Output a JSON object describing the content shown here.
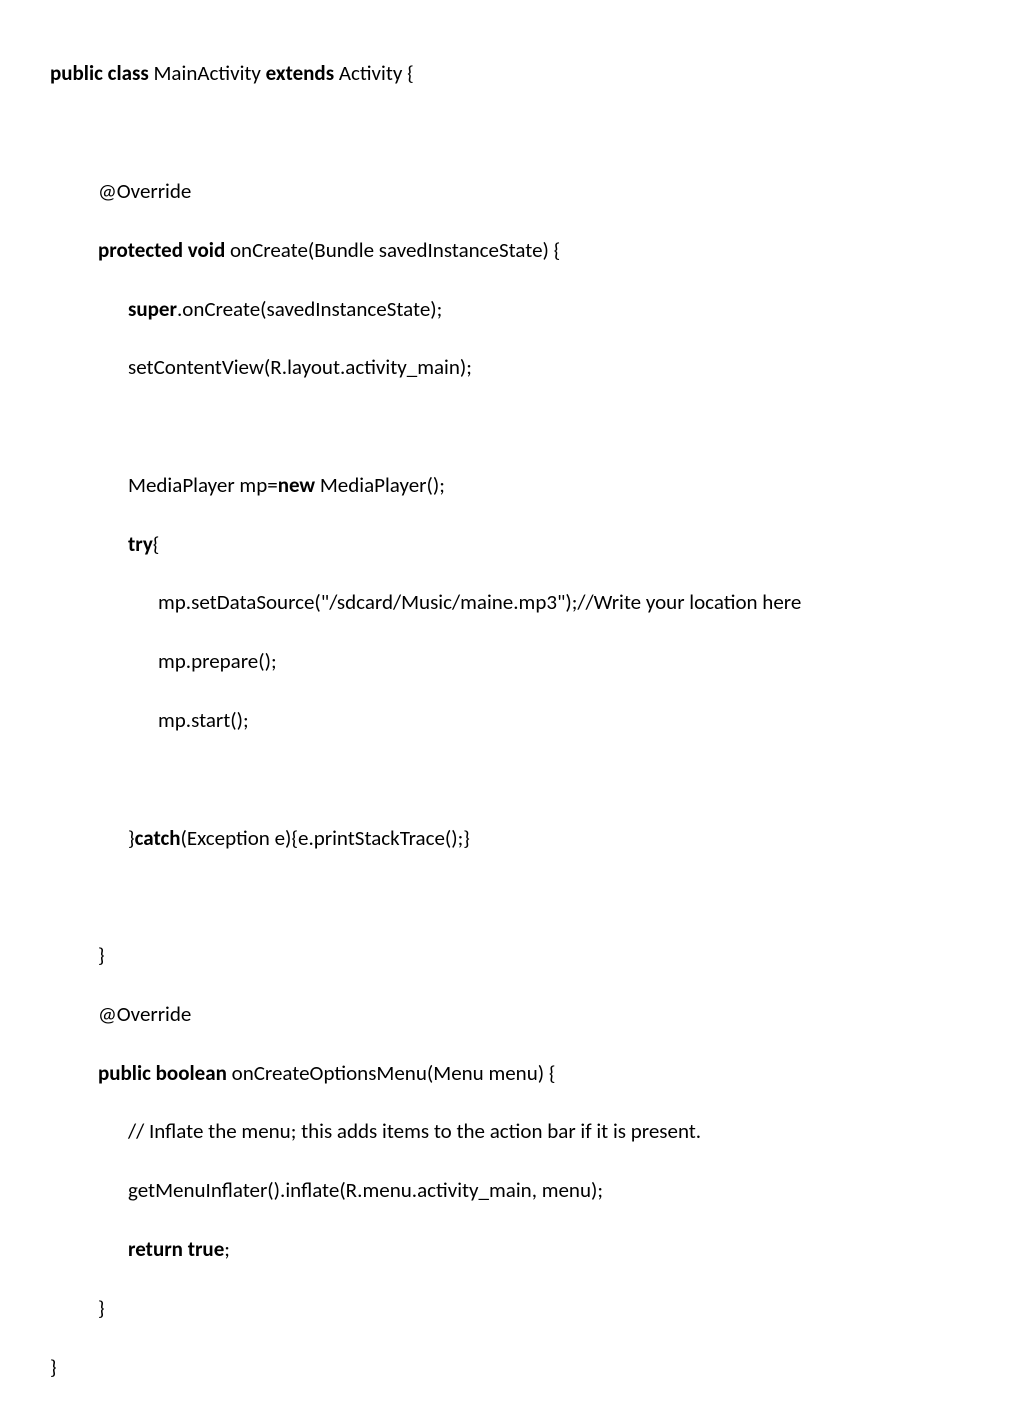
{
  "code": {
    "l1a": "public class",
    "l1b": " MainActivity ",
    "l1c": "extends",
    "l1d": " Activity {",
    "l3": "@Override",
    "l4a": "protected void",
    "l4b": " onCreate(Bundle savedInstanceState) {",
    "l5a": "super",
    "l5b": ".onCreate(savedInstanceState);",
    "l6": "setContentView(R.layout.activity_main);",
    "l8a": "MediaPlayer mp=",
    "l8b": "new",
    "l8c": " MediaPlayer();",
    "l9a": "try",
    "l9b": "{",
    "l10": "mp.setDataSource(\"/sdcard/Music/maine.mp3\");//Write your location here",
    "l11": "mp.prepare();",
    "l12": "mp.start();",
    "l14a": "}",
    "l14b": "catch",
    "l14c": "(Exception e){e.printStackTrace();}",
    "l16": "}",
    "l17": "@Override",
    "l18a": "public boolean",
    "l18b": " onCreateOptionsMenu(Menu menu) {",
    "l19": "// Inflate the menu; this adds items to the action bar if it is present.",
    "l20": "getMenuInflater().inflate(R.menu.activity_main, menu);",
    "l21a": "return true",
    "l21b": ";",
    "l22": "}",
    "l23": "}"
  }
}
